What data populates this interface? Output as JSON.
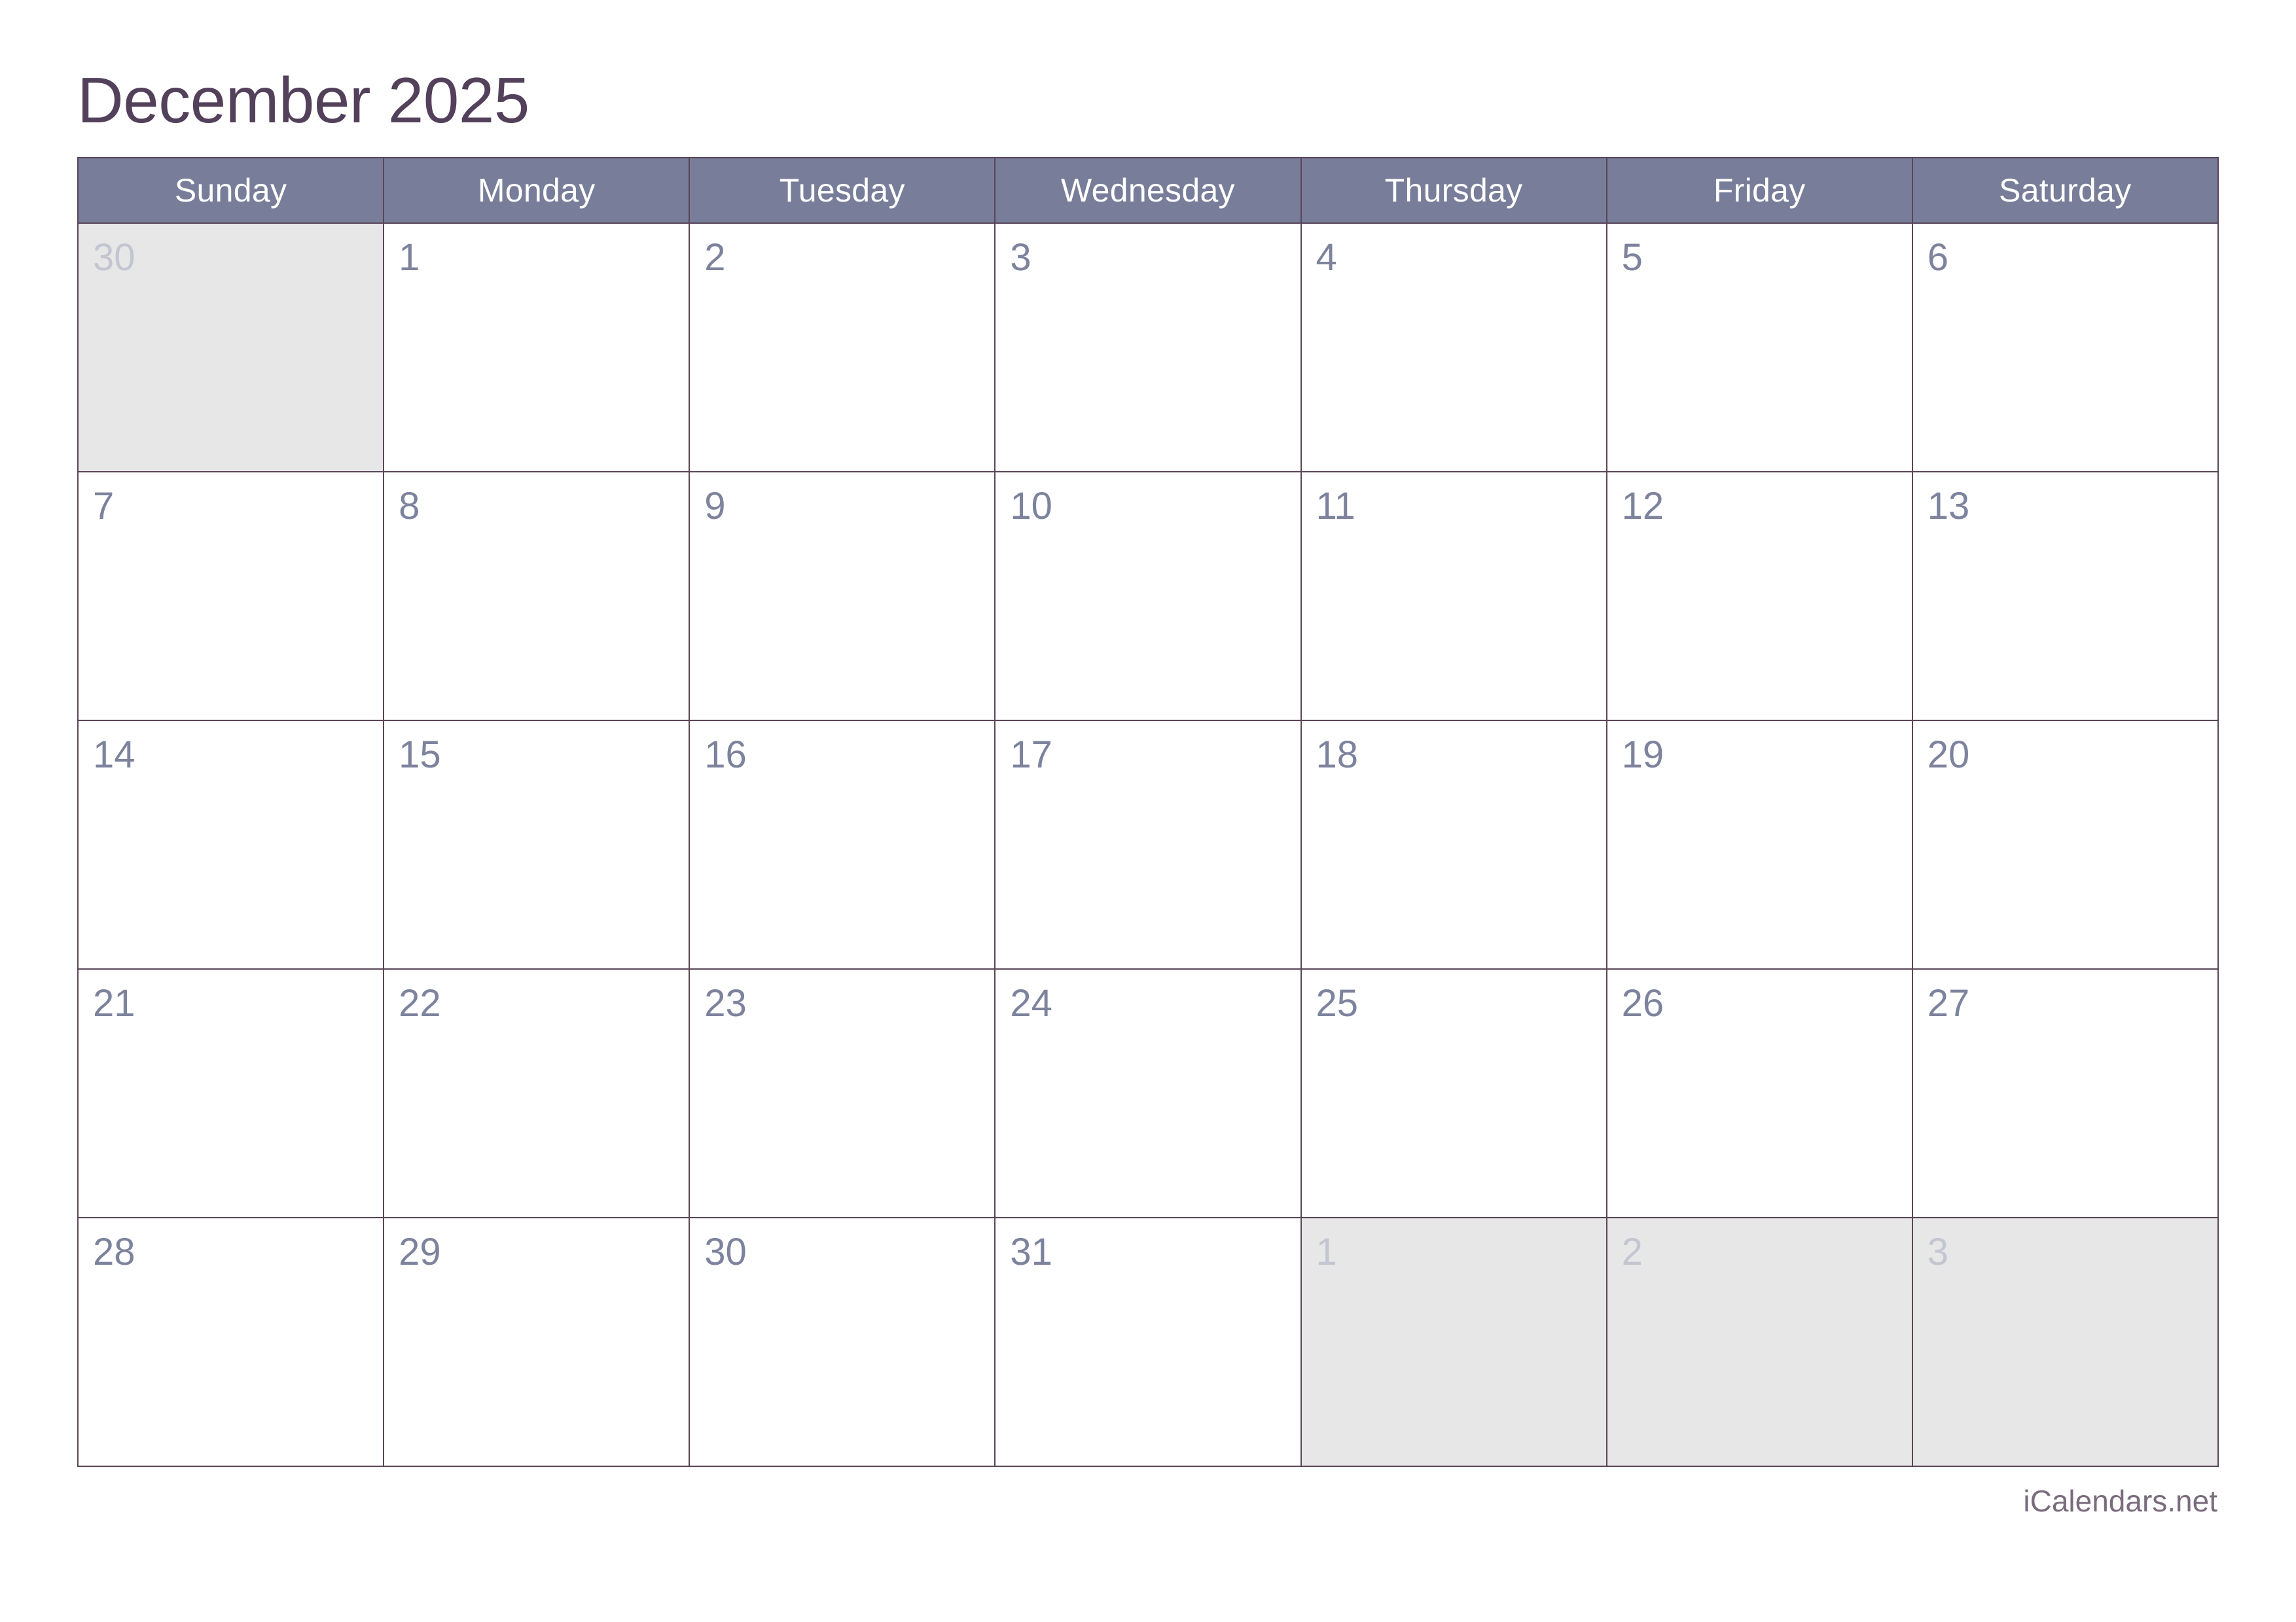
{
  "header": {
    "title": "December 2025"
  },
  "colors": {
    "title_text": "#53405A",
    "header_bg": "#787D99",
    "header_text": "#FFFFFF",
    "grid_border": "#5A4558",
    "day_number": "#7D839D",
    "other_month_bg": "#E7E7E7",
    "other_month_number": "#C3C5D1",
    "footer_text": "#7A6B7D",
    "page_bg": "#FFFFFF"
  },
  "calendar": {
    "month": "December",
    "year": "2025",
    "weekday_headers": [
      "Sunday",
      "Monday",
      "Tuesday",
      "Wednesday",
      "Thursday",
      "Friday",
      "Saturday"
    ],
    "weeks": [
      [
        {
          "day": "30",
          "current_month": false
        },
        {
          "day": "1",
          "current_month": true
        },
        {
          "day": "2",
          "current_month": true
        },
        {
          "day": "3",
          "current_month": true
        },
        {
          "day": "4",
          "current_month": true
        },
        {
          "day": "5",
          "current_month": true
        },
        {
          "day": "6",
          "current_month": true
        }
      ],
      [
        {
          "day": "7",
          "current_month": true
        },
        {
          "day": "8",
          "current_month": true
        },
        {
          "day": "9",
          "current_month": true
        },
        {
          "day": "10",
          "current_month": true
        },
        {
          "day": "11",
          "current_month": true
        },
        {
          "day": "12",
          "current_month": true
        },
        {
          "day": "13",
          "current_month": true
        }
      ],
      [
        {
          "day": "14",
          "current_month": true
        },
        {
          "day": "15",
          "current_month": true
        },
        {
          "day": "16",
          "current_month": true
        },
        {
          "day": "17",
          "current_month": true
        },
        {
          "day": "18",
          "current_month": true
        },
        {
          "day": "19",
          "current_month": true
        },
        {
          "day": "20",
          "current_month": true
        }
      ],
      [
        {
          "day": "21",
          "current_month": true
        },
        {
          "day": "22",
          "current_month": true
        },
        {
          "day": "23",
          "current_month": true
        },
        {
          "day": "24",
          "current_month": true
        },
        {
          "day": "25",
          "current_month": true
        },
        {
          "day": "26",
          "current_month": true
        },
        {
          "day": "27",
          "current_month": true
        }
      ],
      [
        {
          "day": "28",
          "current_month": true
        },
        {
          "day": "29",
          "current_month": true
        },
        {
          "day": "30",
          "current_month": true
        },
        {
          "day": "31",
          "current_month": true
        },
        {
          "day": "1",
          "current_month": false
        },
        {
          "day": "2",
          "current_month": false
        },
        {
          "day": "3",
          "current_month": false
        }
      ]
    ]
  },
  "footer": {
    "attribution": "iCalendars.net"
  }
}
